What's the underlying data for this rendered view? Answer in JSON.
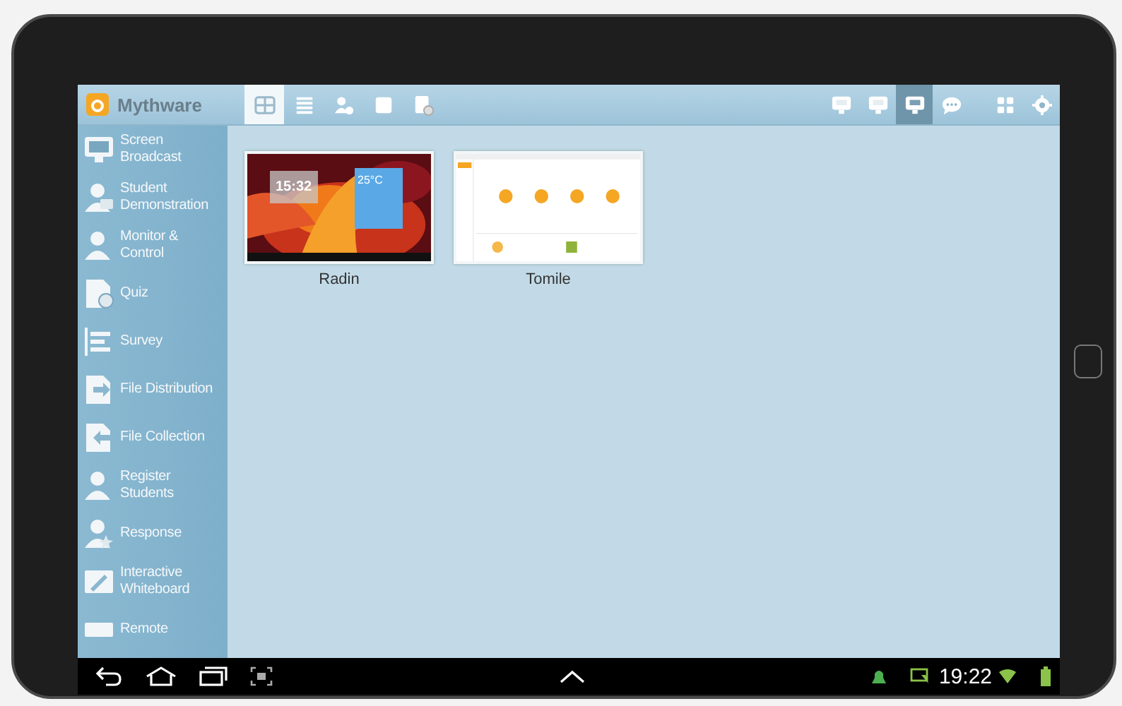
{
  "app": {
    "name": "Mythware"
  },
  "view_tabs": [
    {
      "selected": true
    },
    {
      "selected": false
    },
    {
      "selected": false
    },
    {
      "selected": false
    },
    {
      "selected": false
    }
  ],
  "mode_tabs": [
    {
      "selected": false
    },
    {
      "selected": false
    },
    {
      "selected": true
    },
    {
      "selected": false
    },
    {
      "selected": false
    },
    {
      "selected": false
    }
  ],
  "sidebar": {
    "items": [
      {
        "lines": [
          "Screen",
          "Broadcast"
        ]
      },
      {
        "lines": [
          "Student",
          "Demonstration"
        ]
      },
      {
        "lines": [
          "Monitor &",
          "Control"
        ]
      },
      {
        "lines": [
          "Quiz"
        ]
      },
      {
        "lines": [
          "Survey"
        ]
      },
      {
        "lines": [
          "File Distribution"
        ]
      },
      {
        "lines": [
          "File Collection"
        ]
      },
      {
        "lines": [
          "Register",
          "Students"
        ]
      },
      {
        "lines": [
          "Response"
        ]
      },
      {
        "lines": [
          "Interactive",
          "Whiteboard"
        ]
      },
      {
        "lines": [
          "Remote"
        ]
      }
    ]
  },
  "students": [
    {
      "kind": "desktop",
      "name": "Radin",
      "clock": "15:32",
      "temperature": "25°C"
    },
    {
      "kind": "app",
      "name": "Tomile"
    }
  ],
  "status_bar": {
    "time": "19:22"
  }
}
